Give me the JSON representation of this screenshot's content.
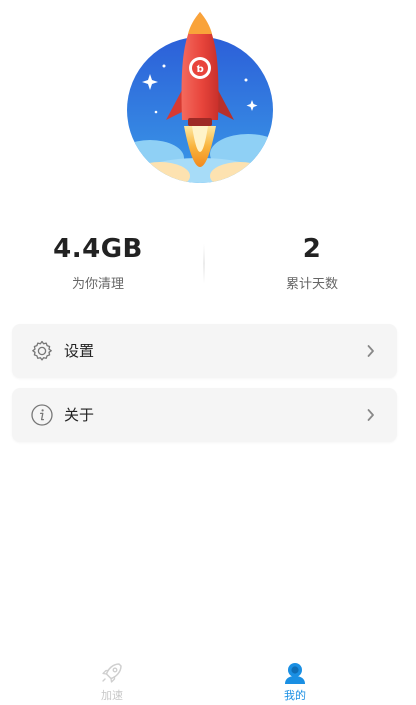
{
  "stats": {
    "cleaned": {
      "value": "4.4GB",
      "label": "为你清理"
    },
    "days": {
      "value": "2",
      "label": "累计天数"
    }
  },
  "menu": {
    "settings": {
      "label": "设置",
      "icon": "gear-icon"
    },
    "about": {
      "label": "关于",
      "icon": "info-icon"
    }
  },
  "tabbar": {
    "tabs": [
      {
        "label": "加速",
        "icon": "rocket-icon",
        "active": false
      },
      {
        "label": "我的",
        "icon": "user-icon",
        "active": true
      }
    ]
  },
  "colors": {
    "accent": "#1a8fe3",
    "inactive_tab": "#c8c8c8",
    "card_bg": "#f5f5f5",
    "rocket_red": "#e8453c",
    "flame": "#f7a531",
    "sky_blue": "#2f6fe0"
  }
}
